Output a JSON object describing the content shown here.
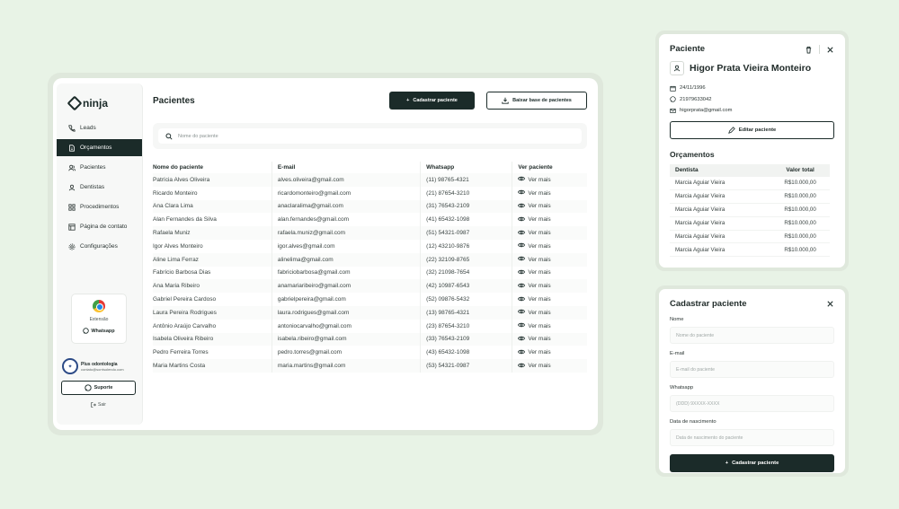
{
  "app": {
    "logo": "ninja",
    "nav": [
      {
        "label": "Leads",
        "icon": "phone-icon"
      },
      {
        "label": "Orçamentos",
        "icon": "document-icon",
        "active": true
      },
      {
        "label": "Pacientes",
        "icon": "users-icon"
      },
      {
        "label": "Dentistas",
        "icon": "user-icon"
      },
      {
        "label": "Procedimentos",
        "icon": "grid-icon"
      },
      {
        "label": "Página de contato",
        "icon": "page-icon"
      },
      {
        "label": "Configurações",
        "icon": "gear-icon"
      }
    ],
    "extension": {
      "label": "Extensão",
      "whatsapp": "Whatsapp"
    },
    "clinic": {
      "name": "Plus odontologia",
      "email": "contato@sorrisolendo.com"
    },
    "support_label": "Suporte",
    "logout_label": "Sair"
  },
  "main": {
    "title": "Pacientes",
    "add_button": "Cadastrar paciente",
    "download_button": "Baixar base de pacientes",
    "search_placeholder": "Nome do paciente",
    "columns": [
      "Nome do paciente",
      "E-mail",
      "Whatsapp",
      "Ver paciente"
    ],
    "rows": [
      {
        "name": "Patrícia Alves Oliveira",
        "email": "alves.oliveira@gmail.com",
        "phone": "(11) 98765-4321",
        "action": "Ver mais"
      },
      {
        "name": "Ricardo Monteiro",
        "email": "ricardomonteiro@gmail.com",
        "phone": "(21) 87654-3210",
        "action": "Ver mais"
      },
      {
        "name": "Ana Clara Lima",
        "email": "anaclaralima@gmail.com",
        "phone": "(31) 76543-2109",
        "action": "Ver mais"
      },
      {
        "name": "Alan Fernandes da Silva",
        "email": "alan.fernandes@gmail.com",
        "phone": "(41) 65432-1098",
        "action": "Ver mais"
      },
      {
        "name": "Rafaela Muniz",
        "email": "rafaela.muniz@gmail.com",
        "phone": "(51) 54321-0987",
        "action": "Ver mais"
      },
      {
        "name": "Igor Alves Monteiro",
        "email": "igor.alves@gmail.com",
        "phone": "(12) 43210-9876",
        "action": "Ver mais"
      },
      {
        "name": "Aline Lima Ferraz",
        "email": "alinelima@gmail.com",
        "phone": "(22) 32109-8765",
        "action": "Ver mais"
      },
      {
        "name": "Fabrício Barbosa Dias",
        "email": "fabriciobarbosa@gmail.com",
        "phone": "(32) 21098-7654",
        "action": "Ver mais"
      },
      {
        "name": "Ana Maria Ribeiro",
        "email": "anamariaribeiro@gmail.com",
        "phone": "(42) 10987-6543",
        "action": "Ver mais"
      },
      {
        "name": "Gabriel Pereira Cardoso",
        "email": "gabrielpereira@gmail.com",
        "phone": "(52) 09876-5432",
        "action": "Ver mais"
      },
      {
        "name": "Laura Pereira Rodrigues",
        "email": "laura.rodrigues@gmail.com",
        "phone": "(13) 98765-4321",
        "action": "Ver mais"
      },
      {
        "name": "Antônio Araújo Carvalho",
        "email": "antoniocarvalho@gmail.com",
        "phone": "(23) 87654-3210",
        "action": "Ver mais"
      },
      {
        "name": "Isabela Oliveira Ribeiro",
        "email": "isabela.ribeiro@gmail.com",
        "phone": "(33) 76543-2109",
        "action": "Ver mais"
      },
      {
        "name": "Pedro Ferreira Torres",
        "email": "pedro.torres@gmail.com",
        "phone": "(43) 65432-1098",
        "action": "Ver mais"
      },
      {
        "name": "Maria Martins Costa",
        "email": "maria.martins@gmail.com",
        "phone": "(53) 54321-0987",
        "action": "Ver mais"
      }
    ]
  },
  "patient_panel": {
    "title": "Paciente",
    "name": "Higor Prata Vieira Monteiro",
    "birth": "24/11/1996",
    "phone": "21979633042",
    "email": "higorprata@gmail.com",
    "edit_button": "Editar paciente",
    "budgets_title": "Orçamentos",
    "budget_columns": [
      "Dentista",
      "Valor total"
    ],
    "budgets": [
      {
        "dentist": "Marcia Aguiar Vieira",
        "value": "R$10.000,00"
      },
      {
        "dentist": "Marcia Aguiar Vieira",
        "value": "R$10.000,00"
      },
      {
        "dentist": "Marcia Aguiar Vieira",
        "value": "R$10.000,00"
      },
      {
        "dentist": "Marcia Aguiar Vieira",
        "value": "R$10.000,00"
      },
      {
        "dentist": "Marcia Aguiar Vieira",
        "value": "R$10.000,00"
      },
      {
        "dentist": "Marcia Aguiar Vieira",
        "value": "R$10.000,00"
      }
    ]
  },
  "register_panel": {
    "title": "Cadastrar paciente",
    "fields": [
      {
        "label": "Nome",
        "placeholder": "Nome do paciente"
      },
      {
        "label": "E-mail",
        "placeholder": "E-mail do paciente"
      },
      {
        "label": "Whatsapp",
        "placeholder": "(DDD) 9XXXX-XXXX"
      },
      {
        "label": "Data de nascimento",
        "placeholder": "Data de nascimento do paciente"
      }
    ],
    "submit": "Cadastrar paciente"
  },
  "colors": {
    "primary": "#1b2b29",
    "background": "#eef5ec"
  }
}
